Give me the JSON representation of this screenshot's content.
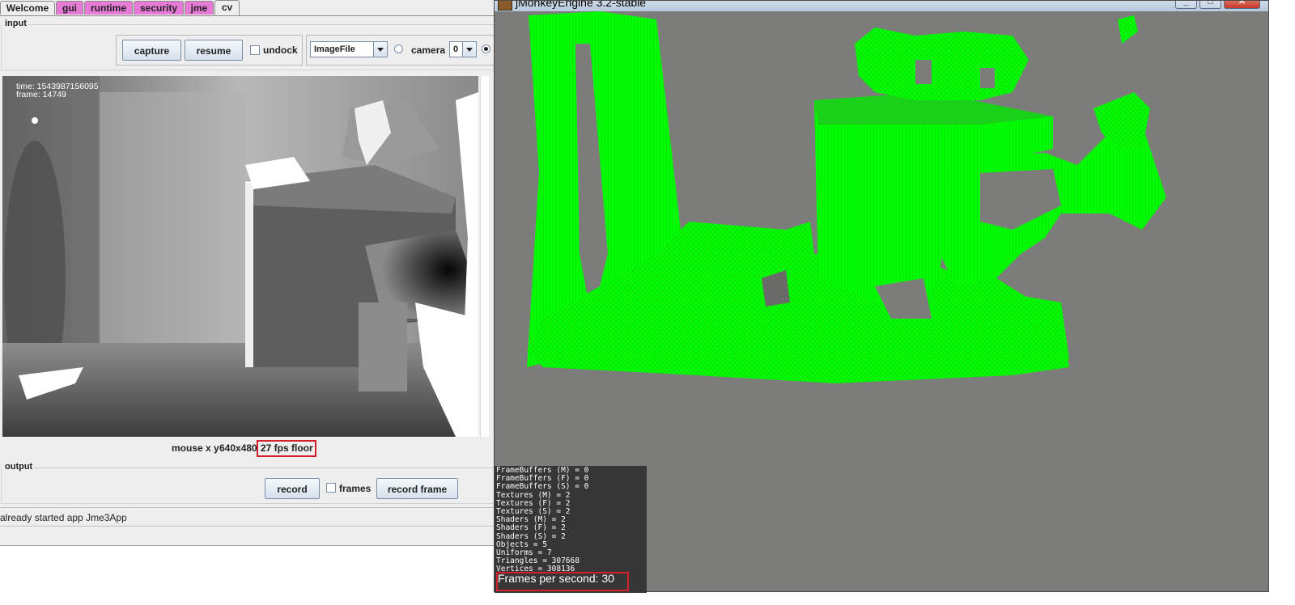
{
  "tabs": [
    {
      "label": "Welcome",
      "color": "#eeeeee"
    },
    {
      "label": "gui",
      "color": "#e67bd6"
    },
    {
      "label": "runtime",
      "color": "#e67bd6"
    },
    {
      "label": "security",
      "color": "#e67bd6"
    },
    {
      "label": "jme",
      "color": "#e67bd6"
    },
    {
      "label": "cv",
      "color": "#eeeeee"
    }
  ],
  "selected_tab": "cv",
  "input": {
    "section_label": "input",
    "capture_label": "capture",
    "resume_label": "resume",
    "undock_label": "undock",
    "source_selected": "ImageFile",
    "camera_label": "camera",
    "camera_selected": "0"
  },
  "overlay": {
    "time": "time: 1543987156095",
    "frame": "frame: 14749"
  },
  "status_line": {
    "mouse": "mouse x y",
    "resolution": "640x480",
    "fps": "27 fps",
    "mode": "floor"
  },
  "output": {
    "section_label": "output",
    "record_label": "record",
    "frames_label": "frames",
    "record_frame_label": "record frame"
  },
  "console_message": "already started app Jme3App",
  "jme": {
    "title": "jMonkeyEngine 3.2-stable",
    "point_cloud_color": "#00ff00",
    "background_color": "#7c7d7b",
    "stats": [
      "FrameBuffers (M) = 0",
      "FrameBuffers (F) = 0",
      "FrameBuffers (S) = 0",
      "Textures (M) = 2",
      "Textures (F) = 2",
      "Textures (S) = 2",
      "Shaders (M) = 2",
      "Shaders (F) = 2",
      "Shaders (S) = 2",
      "Objects = 5",
      "Uniforms = 7",
      "Triangles = 307668",
      "Vertices = 308136"
    ],
    "fps_text": "Frames per second: 30"
  },
  "highlight_color": "#d4202a"
}
